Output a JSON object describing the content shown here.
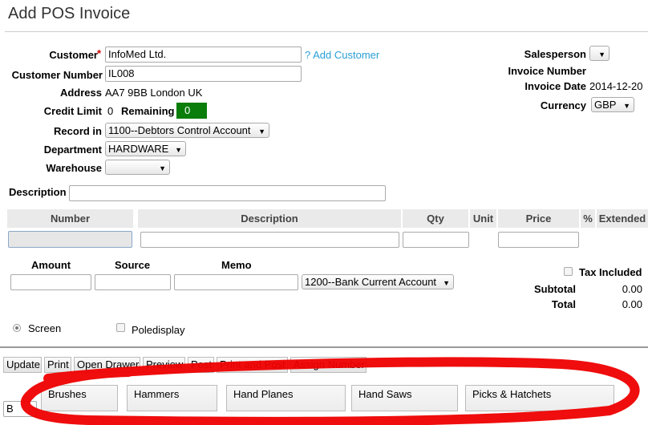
{
  "page": {
    "title": "Add POS Invoice"
  },
  "customer": {
    "customer_label": "Customer",
    "required_mark": "*",
    "customer_value": "InfoMed Ltd.",
    "add_customer_link": "? Add Customer",
    "number_label": "Customer Number",
    "number_value": "IL008",
    "address_label": "Address",
    "address_value": "AA7 9BB London UK",
    "credit_label": "Credit Limit",
    "credit_value": "0",
    "remaining_label": "Remaining",
    "remaining_value": "0",
    "record_label": "Record in",
    "record_value": "1100--Debtors Control Account",
    "department_label": "Department",
    "department_value": "HARDWARE",
    "warehouse_label": "Warehouse",
    "warehouse_value": ""
  },
  "right": {
    "salesperson_label": "Salesperson",
    "invoice_number_label": "Invoice Number",
    "invoice_date_label": "Invoice Date",
    "invoice_date_value": "2014-12-20",
    "currency_label": "Currency",
    "currency_value": "GBP"
  },
  "description": {
    "label": "Description",
    "value": ""
  },
  "lines_table": {
    "headers": {
      "number": "Number",
      "description": "Description",
      "qty": "Qty",
      "unit": "Unit",
      "price": "Price",
      "pct": "%",
      "extended": "Extended"
    }
  },
  "payment": {
    "amount_label": "Amount",
    "source_label": "Source",
    "memo_label": "Memo",
    "account_value": "1200--Bank Current Account"
  },
  "totals": {
    "tax_included_label": "Tax Included",
    "subtotal_label": "Subtotal",
    "subtotal_value": "0.00",
    "total_label": "Total",
    "total_value": "0.00"
  },
  "display": {
    "screen_label": "Screen",
    "poledisplay_label": "Poledisplay"
  },
  "buttons": {
    "update": "Update",
    "print": "Print",
    "open_drawer": "Open Drawer",
    "preview": "Preview",
    "post": "Post",
    "print_and_post": "Print and Post",
    "assign_number": "Assign Number"
  },
  "category_input_value": "B",
  "categories": [
    "Brushes",
    "Hammers",
    "Hand Planes",
    "Hand Saws",
    "Picks & Hatchets"
  ],
  "annotation_color": "#ee0000"
}
